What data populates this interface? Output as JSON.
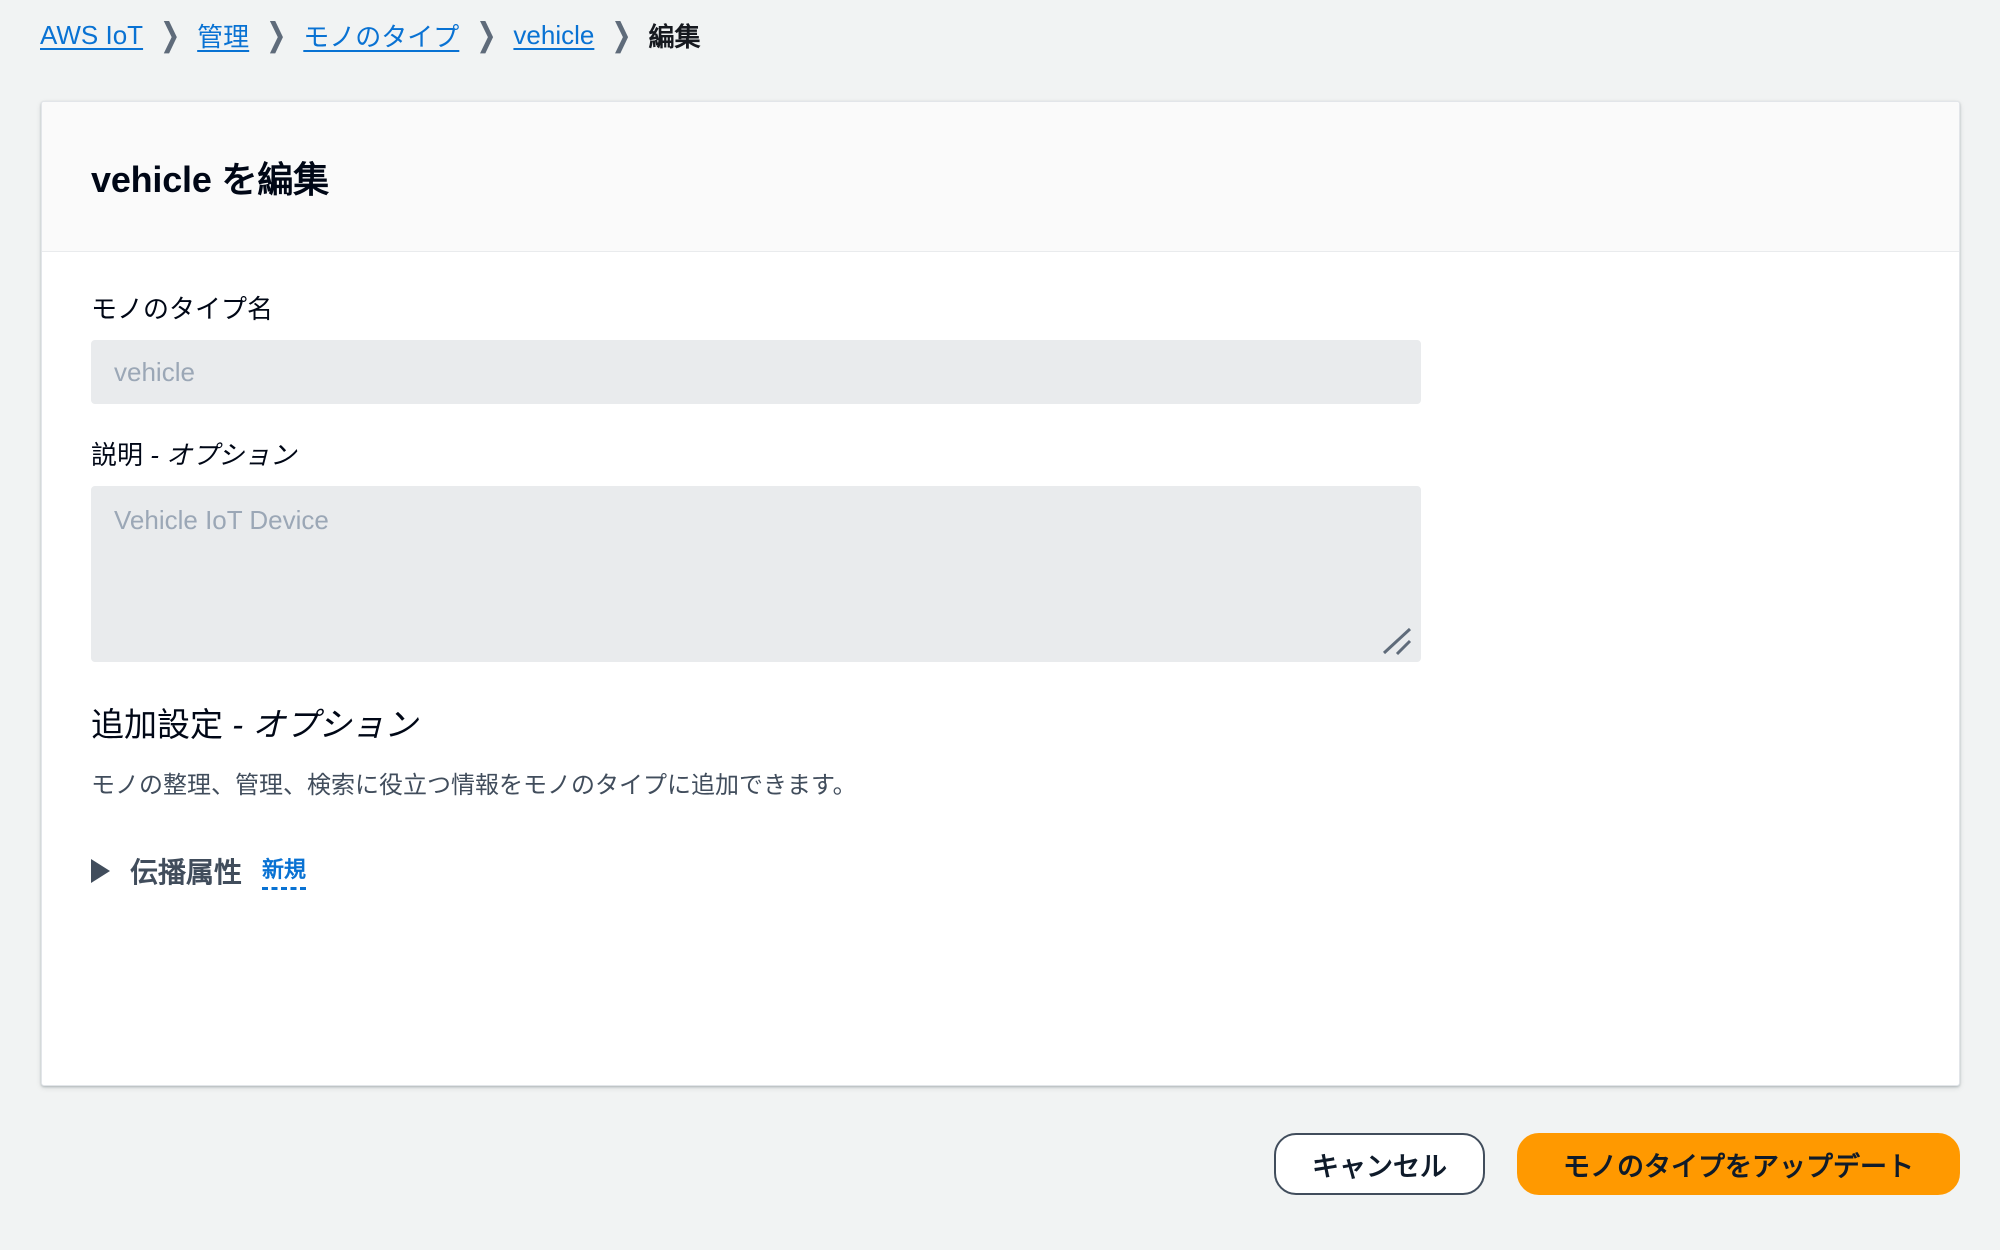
{
  "breadcrumb": {
    "separator": "❯",
    "items": [
      {
        "label": "AWS IoT",
        "type": "link"
      },
      {
        "label": "管理",
        "type": "link"
      },
      {
        "label": "モノのタイプ",
        "type": "link"
      },
      {
        "label": "vehicle",
        "type": "link"
      },
      {
        "label": "編集",
        "type": "current"
      }
    ]
  },
  "card": {
    "title": "vehicle を編集",
    "fields": {
      "thing_type_name": {
        "label": "モノのタイプ名",
        "value": "vehicle",
        "disabled": true
      },
      "description": {
        "label_main": "説明",
        "label_optional": " - オプション",
        "value": "Vehicle IoT Device",
        "disabled": true
      }
    },
    "additional_settings": {
      "heading_main": "追加設定",
      "heading_optional": " - オプション",
      "description": "モノの整理、管理、検索に役立つ情報をモノのタイプに追加できます。",
      "expandable": {
        "label": "伝播属性",
        "badge": "新規",
        "expanded": false,
        "icon": "caret-right-icon"
      }
    }
  },
  "actions": {
    "cancel_label": "キャンセル",
    "submit_label": "モノのタイプをアップデート"
  },
  "colors": {
    "page_background": "#f1f3f3",
    "card_background": "#ffffff",
    "header_background": "#fafafa",
    "link": "#0972d3",
    "primary_button": "#ff9900",
    "disabled_field": "#e9ebed",
    "disabled_text": "#9ba7b6",
    "text": "#000716",
    "muted_text": "#414d5c"
  }
}
